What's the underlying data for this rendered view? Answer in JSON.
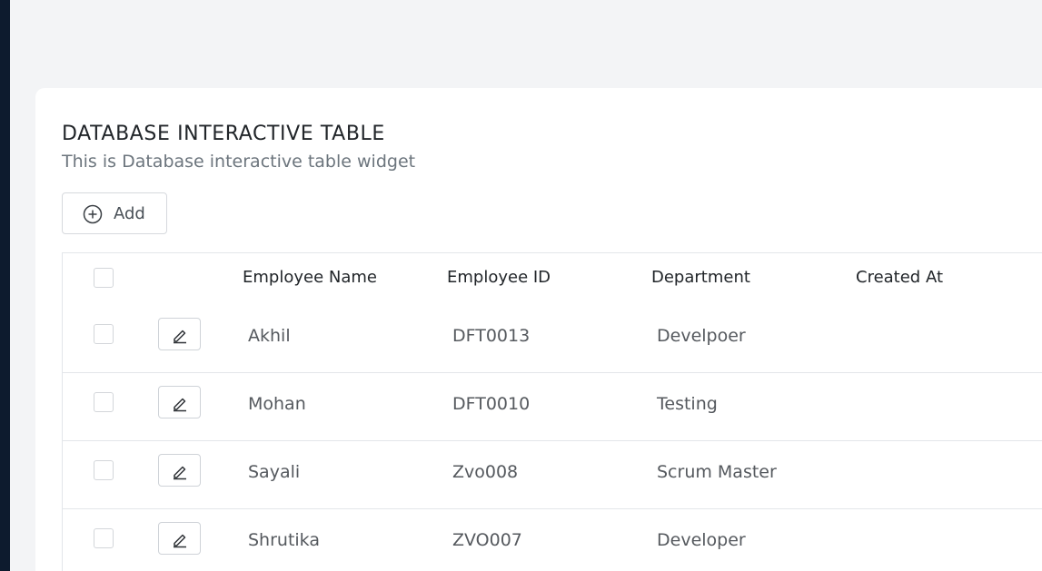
{
  "widget": {
    "title": "DATABASE INTERACTIVE TABLE",
    "subtitle": "This is Database interactive table widget",
    "add_label": "Add"
  },
  "table": {
    "columns": [
      "Employee Name",
      "Employee ID",
      "Department",
      "Created At"
    ],
    "rows": [
      {
        "name": "Akhil",
        "id": "DFT0013",
        "department": "Develpoer",
        "created_at": ""
      },
      {
        "name": "Mohan",
        "id": "DFT0010",
        "department": "Testing",
        "created_at": ""
      },
      {
        "name": "Sayali",
        "id": "Zvo008",
        "department": "Scrum Master",
        "created_at": ""
      },
      {
        "name": "Shrutika",
        "id": "ZVO007",
        "department": "Developer",
        "created_at": ""
      }
    ]
  },
  "icons": {
    "add": "plus-circle-icon",
    "edit": "pencil-icon"
  },
  "colors": {
    "page_background": "#f3f4f6",
    "left_rail": "#0d1b2e",
    "card_background": "#ffffff"
  }
}
